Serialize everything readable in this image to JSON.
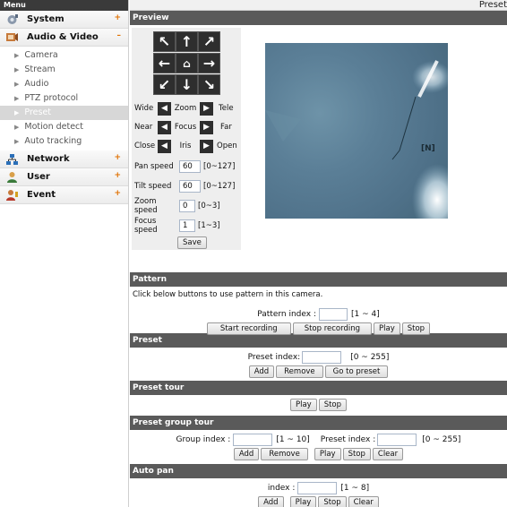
{
  "sidebar": {
    "header": "Menu",
    "categories": [
      {
        "label": "System",
        "mark": "+",
        "icon": "system-icon",
        "color": "#6b7a8f"
      },
      {
        "label": "Audio & Video",
        "mark": "–",
        "icon": "audio-video-icon",
        "color": "#b8612b"
      },
      {
        "label": "Network",
        "mark": "+",
        "icon": "network-icon",
        "color": "#2b6fb8"
      },
      {
        "label": "User",
        "mark": "+",
        "icon": "user-icon",
        "color": "#c8892b"
      },
      {
        "label": "Event",
        "mark": "+",
        "icon": "event-icon",
        "color": "#b83a2b"
      }
    ],
    "sub_items": [
      "Camera",
      "Stream",
      "Audio",
      "PTZ protocol",
      "Preset",
      "Motion detect",
      "Auto tracking"
    ],
    "active_sub": "Preset"
  },
  "page_title": "Preset",
  "preview": {
    "title": "Preview",
    "zoom": {
      "left": "Wide",
      "mid": "Zoom",
      "right": "Tele"
    },
    "focus": {
      "left": "Near",
      "mid": "Focus",
      "right": "Far"
    },
    "iris": {
      "left": "Close",
      "mid": "Iris",
      "right": "Open"
    },
    "speeds": [
      {
        "label": "Pan speed",
        "value": "60",
        "range": "[0~127]"
      },
      {
        "label": "Tilt speed",
        "value": "60",
        "range": "[0~127]"
      },
      {
        "label": "Zoom speed",
        "value": "0",
        "range": "[0~3]"
      },
      {
        "label": "Focus speed",
        "value": "1",
        "range": "[1~3]"
      }
    ],
    "save_label": "Save",
    "video_overlay": "[N]"
  },
  "pattern": {
    "title": "Pattern",
    "note": "Click below buttons to use pattern in this camera.",
    "index_label": "Pattern index :",
    "range": "[1 ~ 4]",
    "start_label": "Start recording",
    "stop_rec_label": "Stop recording",
    "play_label": "Play",
    "stop_label": "Stop"
  },
  "preset": {
    "title": "Preset",
    "index_label": "Preset index:",
    "range": "[0 ~ 255]",
    "add_label": "Add",
    "remove_label": "Remove",
    "goto_label": "Go to preset"
  },
  "preset_tour": {
    "title": "Preset tour",
    "play_label": "Play",
    "stop_label": "Stop"
  },
  "group_tour": {
    "title": "Preset group tour",
    "group_label": "Group index :",
    "group_range": "[1 ~ 10]",
    "preset_label": "Preset index :",
    "preset_range": "[0 ~ 255]",
    "add_label": "Add",
    "remove_label": "Remove",
    "play_label": "Play",
    "stop_label": "Stop",
    "clear_label": "Clear"
  },
  "auto_pan": {
    "title": "Auto pan",
    "index_label": "index :",
    "range": "[1 ~ 8]",
    "add_label": "Add",
    "play_label": "Play",
    "stop_label": "Stop",
    "clear_label": "Clear"
  }
}
